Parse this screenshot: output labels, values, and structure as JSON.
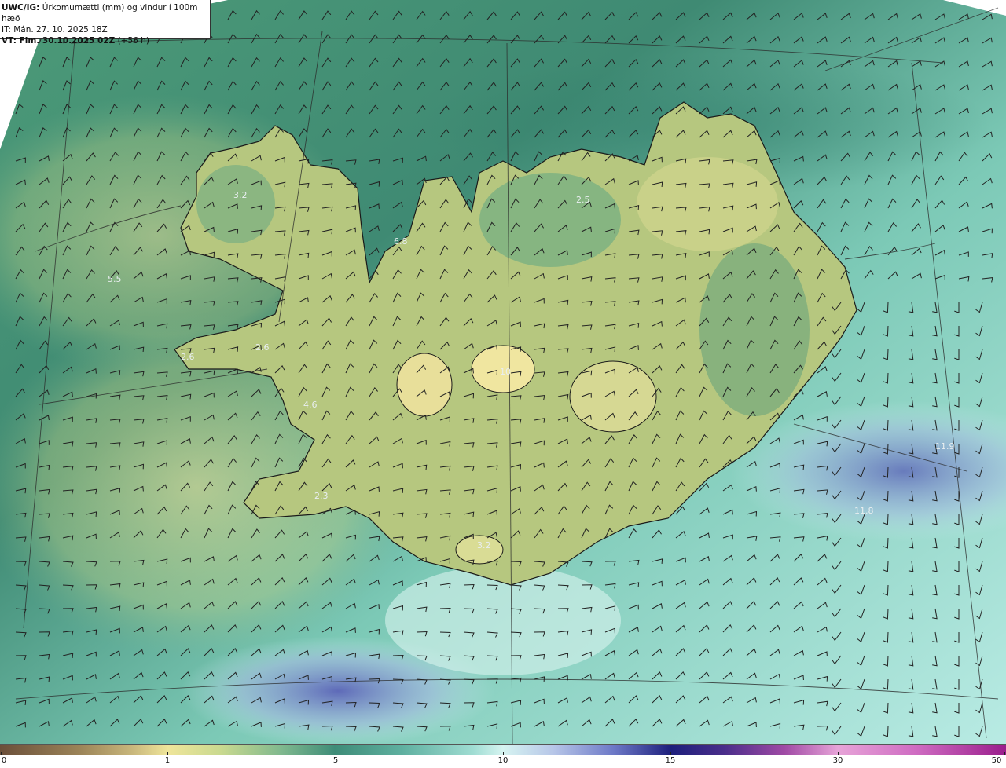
{
  "header": {
    "title_bold": "UWC/IG:",
    "title_rest": " Úrkomumætti (mm) og vindur í 100m hæð",
    "initial_time": "IT: Mán. 27. 10. 2025 18Z",
    "valid_prefix": "VT: Fim. 30.10.2025 02Z",
    "valid_suffix": " (+56 h)"
  },
  "value_labels": [
    "3.2",
    "2.5",
    "6.8",
    "5.5",
    "2.6",
    "2.6",
    "4.6",
    "2.3",
    "3.2",
    "11.9",
    "11.8",
    "10"
  ],
  "colorbar": {
    "ticks": [
      "0",
      "1",
      "5",
      "10",
      "15",
      "30",
      "50"
    ],
    "colors": {
      "low_brown": "#6b4f3a",
      "yellow": "#efe59a",
      "green": "#3e8c78",
      "pale_cyan": "#d6f4f1",
      "navy": "#1d1f7c",
      "pink": "#e7a4d8",
      "magenta": "#9a1e8c"
    }
  }
}
